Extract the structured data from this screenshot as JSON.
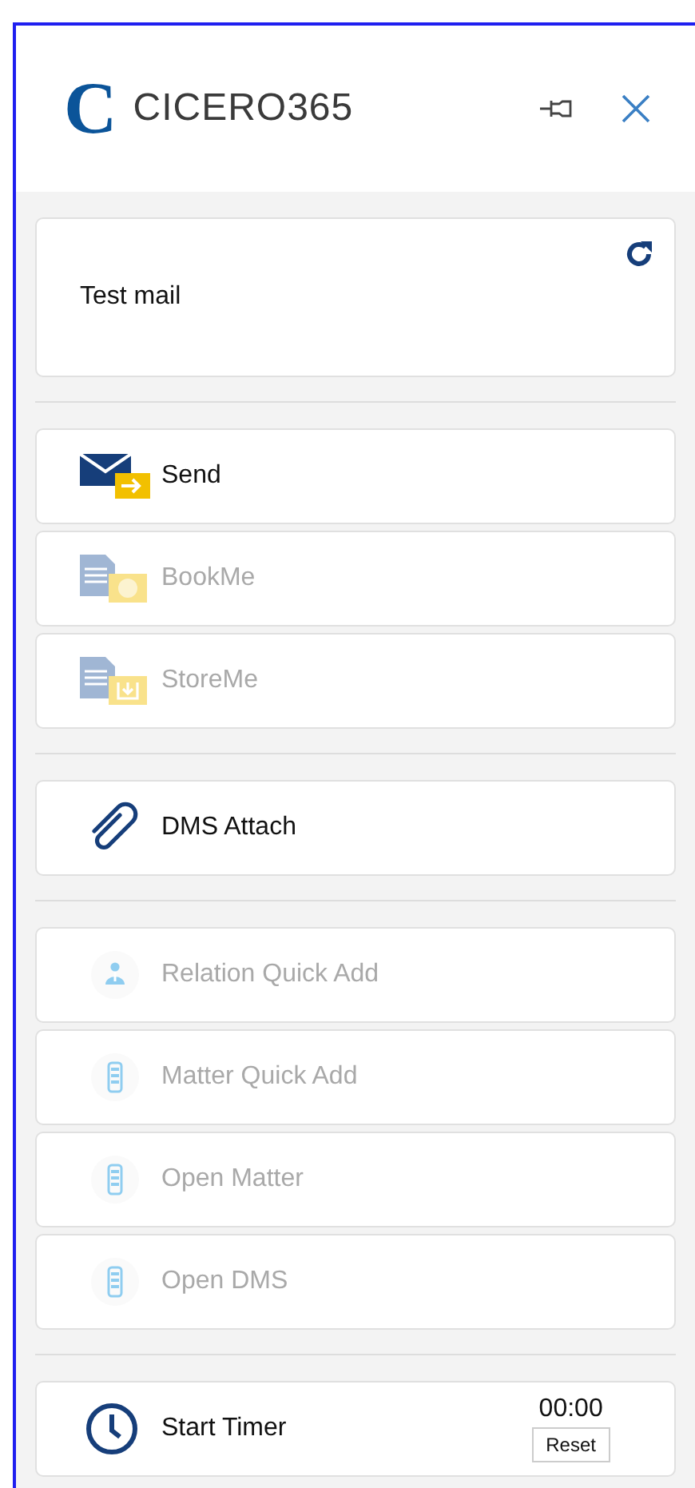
{
  "header": {
    "logo_letter": "C",
    "title": "CICERO365"
  },
  "mail": {
    "subject": "Test mail"
  },
  "groups": [
    [
      {
        "kind": "send",
        "label": "Send",
        "disabled": false
      },
      {
        "kind": "book",
        "label": "BookMe",
        "disabled": true
      },
      {
        "kind": "store",
        "label": "StoreMe",
        "disabled": true
      }
    ],
    [
      {
        "kind": "attach",
        "label": "DMS Attach",
        "disabled": false
      }
    ],
    [
      {
        "kind": "relation",
        "label": "Relation Quick Add",
        "disabled": true
      },
      {
        "kind": "matter",
        "label": "Matter Quick Add",
        "disabled": true
      },
      {
        "kind": "matter",
        "label": "Open Matter",
        "disabled": true
      },
      {
        "kind": "matter",
        "label": "Open DMS",
        "disabled": true
      }
    ]
  ],
  "timer": {
    "label": "Start Timer",
    "time": "00:00",
    "reset": "Reset"
  }
}
